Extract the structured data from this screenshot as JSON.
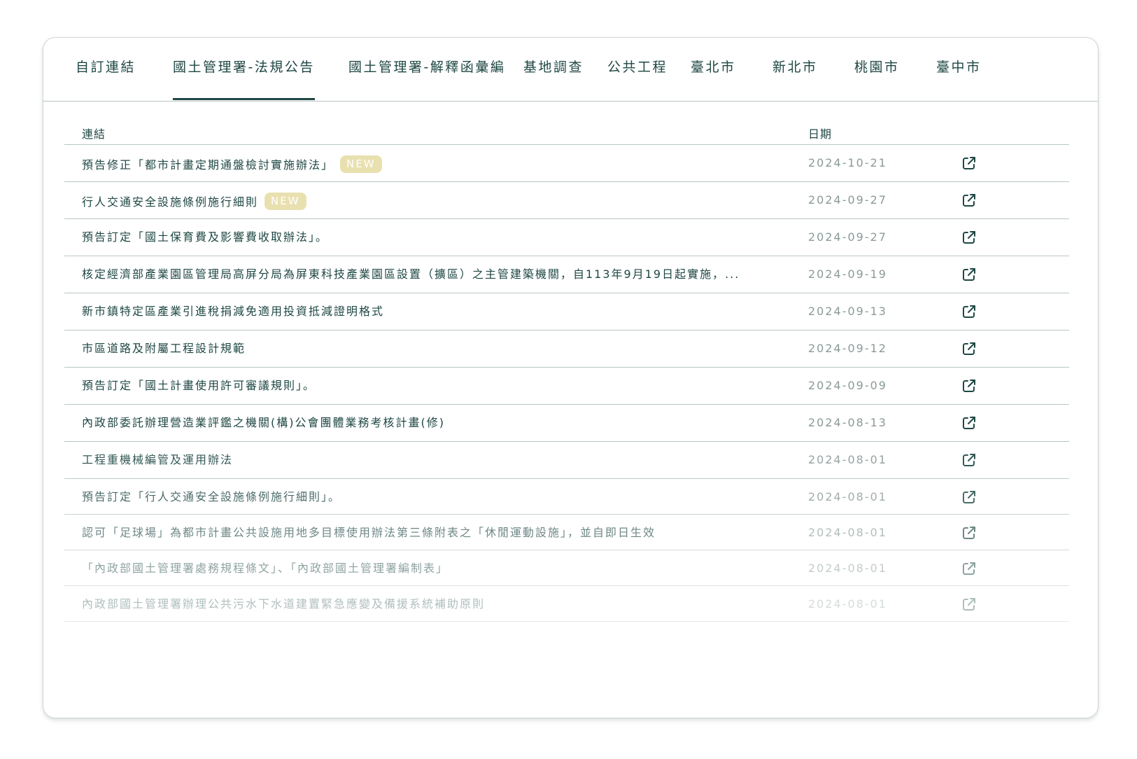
{
  "tabs": [
    {
      "label": "自訂連結",
      "active": false
    },
    {
      "label": "國土管理署-法規公告",
      "active": true
    },
    {
      "label": "國土管理署-解釋函彙編",
      "active": false
    },
    {
      "label": "基地調查",
      "active": false
    },
    {
      "label": "公共工程",
      "active": false
    },
    {
      "label": "臺北市",
      "active": false
    },
    {
      "label": "新北市",
      "active": false
    },
    {
      "label": "桃園市",
      "active": false
    },
    {
      "label": "臺中市",
      "active": false
    }
  ],
  "table": {
    "headers": {
      "link": "連結",
      "date": "日期"
    },
    "badge_label": "NEW",
    "open_icon": "external-link-icon",
    "rows": [
      {
        "title": "預告修正「都市計畫定期通盤檢討實施辦法」",
        "date": "2024-10-21",
        "is_new": true
      },
      {
        "title": "行人交通安全設施條例施行細則",
        "date": "2024-09-27",
        "is_new": true
      },
      {
        "title": "預告訂定「國土保育費及影響費收取辦法」。",
        "date": "2024-09-27",
        "is_new": false
      },
      {
        "title": "核定經濟部產業園區管理局高屏分局為屏東科技產業園區設置（擴區）之主管建築機關，自113年9月19日起實施，...",
        "date": "2024-09-19",
        "is_new": false
      },
      {
        "title": "新市鎮特定區產業引進稅捐減免適用投資抵減證明格式",
        "date": "2024-09-13",
        "is_new": false
      },
      {
        "title": "市區道路及附屬工程設計規範",
        "date": "2024-09-12",
        "is_new": false
      },
      {
        "title": "預告訂定「國土計畫使用許可審議規則」。",
        "date": "2024-09-09",
        "is_new": false
      },
      {
        "title": "內政部委託辦理營造業評鑑之機關(構)公會團體業務考核計畫(修)",
        "date": "2024-08-13",
        "is_new": false
      },
      {
        "title": "工程重機械編管及運用辦法",
        "date": "2024-08-01",
        "is_new": false
      },
      {
        "title": "預告訂定「行人交通安全設施條例施行細則」。",
        "date": "2024-08-01",
        "is_new": false
      },
      {
        "title": "認可「足球場」為都市計畫公共設施用地多目標使用辦法第三條附表之「休閒運動設施」，並自即日生效",
        "date": "2024-08-01",
        "is_new": false
      },
      {
        "title": "「內政部國土管理署處務規程條文」、「內政部國土管理署編制表」",
        "date": "2024-08-01",
        "is_new": false
      },
      {
        "title": "內政部國土管理署辦理公共污水下水道建置緊急應變及備援系統補助原則",
        "date": "2024-08-01",
        "is_new": false
      }
    ]
  }
}
